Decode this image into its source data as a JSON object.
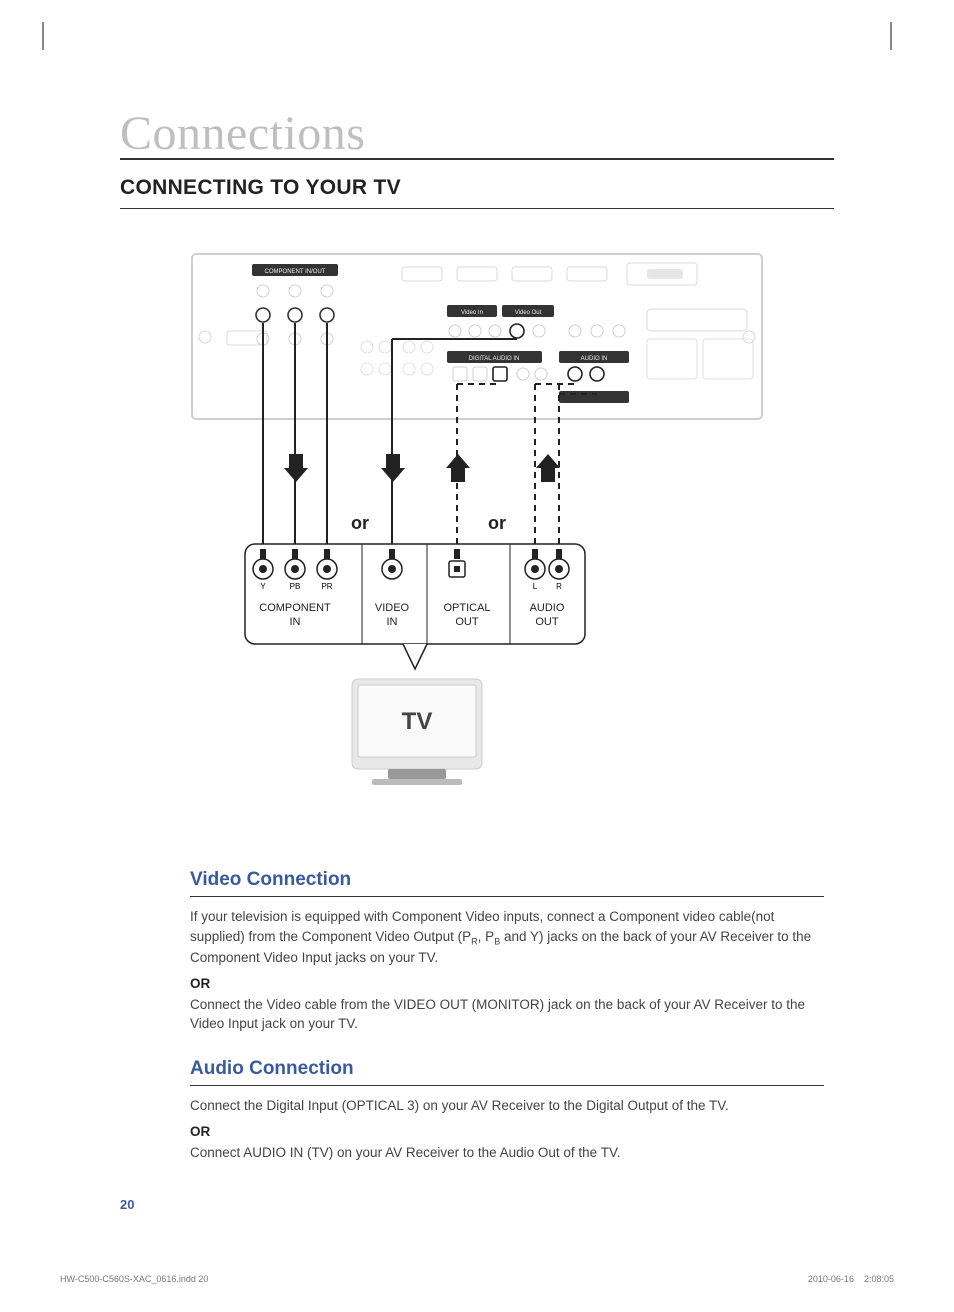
{
  "chapter_title": "Connections",
  "section_title": "CONNECTING TO YOUR TV",
  "diagram": {
    "or": "or",
    "component_in": "COMPONENT\nIN",
    "video_in": "VIDEO\nIN",
    "optical_out": "OPTICAL\nOUT",
    "audio_out": "AUDIO\nOUT",
    "y": "Y",
    "pb": "PB",
    "pr": "PR",
    "l": "L",
    "r": "R",
    "tv": "TV",
    "panel_component_in_out": "COMPONENT IN/OUT",
    "panel_video_in": "Video In",
    "panel_video_out": "Video Out",
    "panel_digital_audio_in": "DIGITAL AUDIO IN",
    "panel_audio_in": "AUDIO IN"
  },
  "video": {
    "heading": "Video Connection",
    "p1_a": "If your television is equipped with Component Video inputs, connect a Component video cable(not supplied) from the Component Video Output (P",
    "p1_r": "R",
    "p1_b": ", P",
    "p1_bsub": "B",
    "p1_c": " and Y) jacks on the back of your AV Receiver to the Component Video Input jacks on your TV.",
    "or": "OR",
    "p2": "Connect the Video cable from the VIDEO OUT (MONITOR) jack on the back of your AV Receiver to the Video Input jack on your TV."
  },
  "audio": {
    "heading": "Audio Connection",
    "p1": "Connect the Digital Input (OPTICAL 3) on your AV Receiver to the Digital Output of the TV.",
    "or": "OR",
    "p2": "Connect AUDIO IN (TV) on your AV Receiver to the Audio Out of the TV."
  },
  "page_number": "20",
  "footer_file": "HW-C500-C560S-XAC_0616.indd   20",
  "footer_date": "2010-06-16",
  "footer_time": "2:08:05"
}
